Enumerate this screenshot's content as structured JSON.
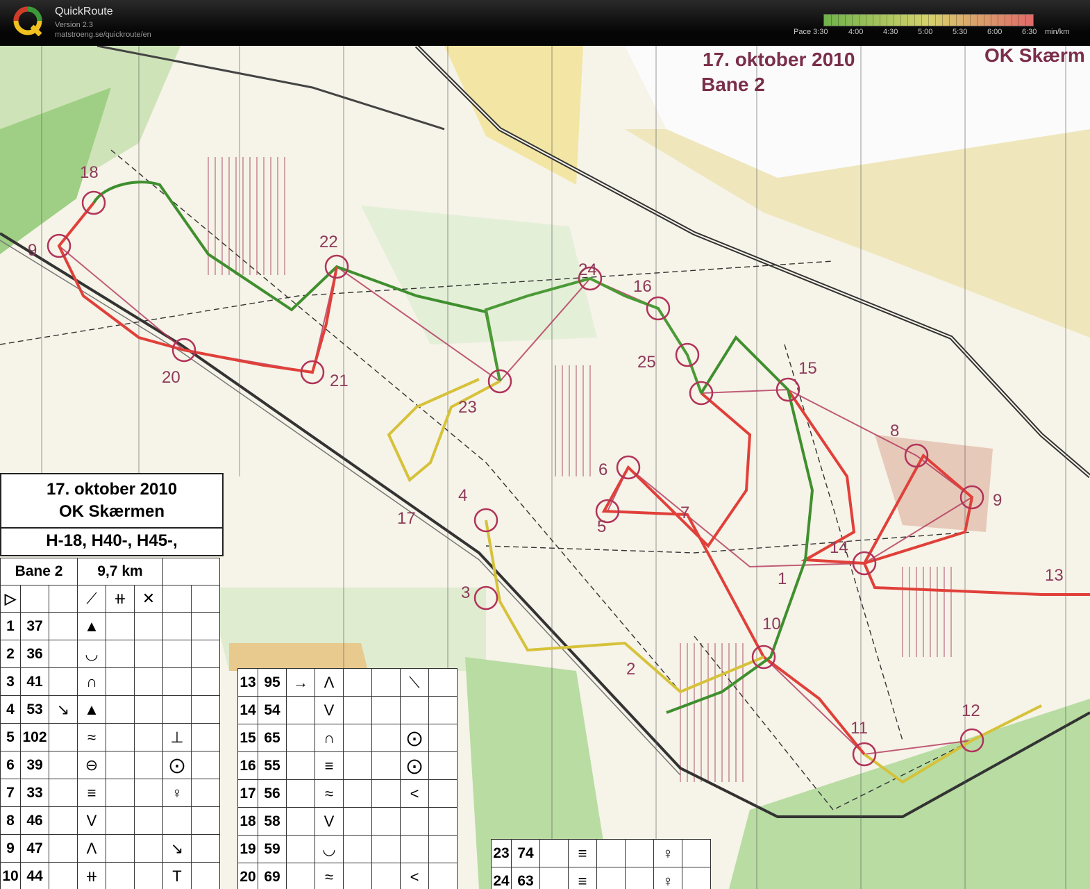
{
  "app": {
    "name": "QuickRoute",
    "version": "Version 2.3",
    "url": "matstroeng.se/quickroute/en"
  },
  "pace_scale": {
    "labels": [
      "Pace 3:30",
      "4:00",
      "4:30",
      "5:00",
      "5:30",
      "6:00",
      "6:30",
      "min/km"
    ],
    "colors": {
      "fast": "#6fb24a",
      "mid": "#d6d26c",
      "slow": "#e06a6a"
    }
  },
  "map": {
    "header_date": "17. oktober 2010",
    "header_course": "Bane 2",
    "header_club": "OK Skærm",
    "control_labels": [
      "18",
      "9",
      "22",
      "24",
      "16",
      "20",
      "21",
      "23",
      "25",
      "15",
      "8",
      "6",
      "5",
      "4",
      "17",
      "7",
      "9",
      "14",
      "3",
      "1",
      "13",
      "10",
      "2",
      "11",
      "12"
    ],
    "route_colors": {
      "green": "#3f8f2e",
      "yellow": "#d6c23a",
      "red": "#e0403a"
    },
    "control_color": "#b1345a"
  },
  "legend": {
    "date": "17. oktober 2010",
    "club": "OK Skærmen",
    "classes": "H-18, H40-, H45-,",
    "course": "Bane 2",
    "length": "9,7 km",
    "rows_left": [
      {
        "num": "1",
        "code": "37",
        "dir": "",
        "feat": "▲",
        "extra": ""
      },
      {
        "num": "2",
        "code": "36",
        "dir": "",
        "feat": "◡",
        "extra": ""
      },
      {
        "num": "3",
        "code": "41",
        "dir": "",
        "feat": "∩",
        "extra": ""
      },
      {
        "num": "4",
        "code": "53",
        "dir": "↘",
        "feat": "▲",
        "extra": ""
      },
      {
        "num": "5",
        "code": "102",
        "dir": "",
        "feat": "≈",
        "extra": "⊥"
      },
      {
        "num": "6",
        "code": "39",
        "dir": "",
        "feat": "⊖",
        "extra": "⨀"
      },
      {
        "num": "7",
        "code": "33",
        "dir": "",
        "feat": "≡",
        "extra": "♀"
      },
      {
        "num": "8",
        "code": "46",
        "dir": "",
        "feat": "V",
        "extra": ""
      },
      {
        "num": "9",
        "code": "47",
        "dir": "",
        "feat": "Λ",
        "extra": "↘"
      },
      {
        "num": "10",
        "code": "44",
        "dir": "",
        "feat": "⧺",
        "extra": "T"
      }
    ],
    "rows_mid": [
      {
        "num": "13",
        "code": "95",
        "dir": "→",
        "feat": "Λ",
        "extra": "⟍"
      },
      {
        "num": "14",
        "code": "54",
        "dir": "",
        "feat": "V",
        "extra": ""
      },
      {
        "num": "15",
        "code": "65",
        "dir": "",
        "feat": "∩",
        "extra": "⨀"
      },
      {
        "num": "16",
        "code": "55",
        "dir": "",
        "feat": "≡",
        "extra": "⨀"
      },
      {
        "num": "17",
        "code": "56",
        "dir": "",
        "feat": "≈",
        "extra": "<"
      },
      {
        "num": "18",
        "code": "58",
        "dir": "",
        "feat": "V",
        "extra": ""
      },
      {
        "num": "19",
        "code": "59",
        "dir": "",
        "feat": "◡",
        "extra": ""
      },
      {
        "num": "20",
        "code": "69",
        "dir": "",
        "feat": "≈",
        "extra": "<"
      }
    ],
    "rows_right": [
      {
        "num": "23",
        "code": "74",
        "dir": "",
        "feat": "≡",
        "extra": "♀"
      },
      {
        "num": "24",
        "code": "63",
        "dir": "",
        "feat": "≡",
        "extra": "♀"
      }
    ]
  }
}
